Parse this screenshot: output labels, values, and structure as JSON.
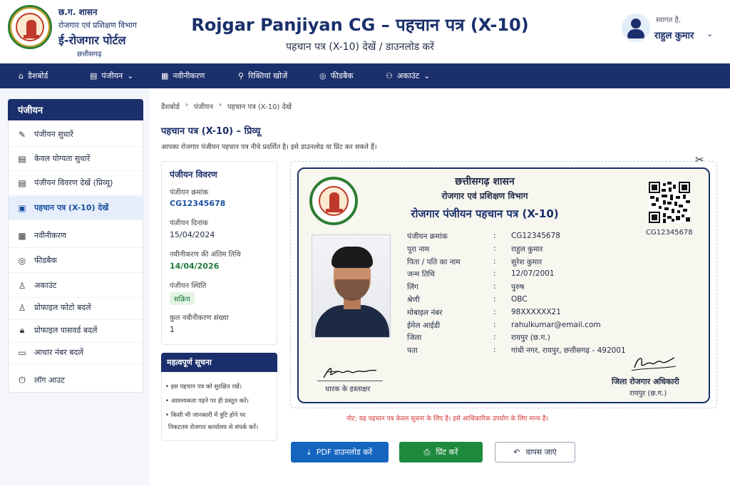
{
  "header": {
    "gov": "छ.ग. शासन",
    "dept": "रोजगार एवं प्रशिक्षण विभाग",
    "portal": "ई-रोजगार पोर्टल",
    "state": "छत्तीसगढ़",
    "title": "Rojgar Panjiyan CG – पहचान पत्र (X-10)",
    "subtitle": "पहचान पत्र (X-10) देखें / डाउनलोड करें",
    "welcome": "स्वागत है,",
    "user": "राहुल कुमार"
  },
  "nav": [
    {
      "label": "डैशबोर्ड",
      "icon": "home-icon"
    },
    {
      "label": "पंजीयन",
      "icon": "document-icon",
      "dropdown": true
    },
    {
      "label": "नवीनीकरण",
      "icon": "calendar-icon"
    },
    {
      "label": "रिक्तियां खोजें",
      "icon": "search-icon"
    },
    {
      "label": "फीडबैक",
      "icon": "feedback-icon"
    },
    {
      "label": "अकाउंट",
      "icon": "users-icon",
      "dropdown": true
    }
  ],
  "sidebar": {
    "title": "पंजीयन",
    "items": [
      {
        "label": "पंजीयन सुधारें",
        "icon": "edit-icon"
      },
      {
        "label": "केवल योग्यता सुधारें",
        "icon": "doc-edit-icon"
      },
      {
        "label": "पंजीयन विवरण देखें (प्रिव्यू)",
        "icon": "doc-view-icon"
      },
      {
        "label": "पहचान पत्र (X-10) देखें",
        "icon": "id-card-icon",
        "active": true
      },
      {
        "label": "नवीनीकरण",
        "icon": "calendar-icon"
      },
      {
        "label": "फीडबैक",
        "icon": "feedback-icon"
      },
      {
        "label": "अकाउंट",
        "icon": "user-icon"
      },
      {
        "label": "प्रोफाइल फोटो बदलें",
        "icon": "user-photo-icon"
      },
      {
        "label": "प्रोफाइल पासवर्ड बदलें",
        "icon": "lock-icon"
      },
      {
        "label": "आधार नंबर बदलें",
        "icon": "card-icon"
      },
      {
        "label": "लॉग आउट",
        "icon": "power-icon"
      }
    ]
  },
  "breadcrumb": [
    "डैशबोर्ड",
    "पंजीयन",
    "पहचान पत्र (X-10) देखें"
  ],
  "page": {
    "title": "पहचान पत्र (X-10) – प्रिव्यू",
    "desc": "आपका रोजगार पंजीयन पहचान पत्र नीचे प्रदर्शित है। इसे डाउनलोड या प्रिंट कर सकते हैं।"
  },
  "details": {
    "title": "पंजीयन विवरण",
    "reg_no_label": "पंजीयन क्रमांक",
    "reg_no": "CG12345678",
    "reg_date_label": "पंजीयन दिनांक",
    "reg_date": "15/04/2024",
    "renew_label": "नवीनीकरण की अंतिम तिथि",
    "renew_date": "14/04/2026",
    "status_label": "पंजीयन स्थिति",
    "status": "सक्रिय",
    "count_label": "कुल नवीनीकरण संख्या",
    "count": "1"
  },
  "notice": {
    "title": "महत्वपूर्ण सूचना",
    "items": [
      "• इस पहचान पत्र को सुरक्षित रखें।",
      "• आवश्यकता पड़ने पर ही प्रस्तुत करें।",
      "• किसी भी जानकारी में त्रुटि होने पर",
      "निकटतम रोजगार कार्यालय से संपर्क करें।"
    ]
  },
  "card": {
    "gov": "छत्तीसगढ़ शासन",
    "dept": "रोजगार एवं प्रशिक्षण विभाग",
    "title": "रोजगार पंजीयन पहचान पत्र (X-10)",
    "qr_id": "CG12345678",
    "fields": [
      {
        "label": "पंजीयन क्रमांक",
        "value": "CG12345678"
      },
      {
        "label": "पूरा नाम",
        "value": "राहुल कुमार"
      },
      {
        "label": "पिता / पति का नाम",
        "value": "सुरेश कुमार"
      },
      {
        "label": "जन्म तिथि",
        "value": "12/07/2001"
      },
      {
        "label": "लिंग",
        "value": "पुरुष"
      },
      {
        "label": "श्रेणी",
        "value": "OBC"
      },
      {
        "label": "मोबाइल नंबर",
        "value": "98XXXXXX21"
      },
      {
        "label": "ईमेल आईडी",
        "value": "rahulkumar@email.com"
      },
      {
        "label": "जिला",
        "value": "रायपुर (छ.ग.)"
      },
      {
        "label": "पता",
        "value": "गांधी नगर, रायपुर, छत्तीसगढ़ - 492001"
      }
    ],
    "holder_sig": "धारक के हस्ताक्षर",
    "officer": "जिला रोजगार अधिकारी",
    "officer_place": "रायपुर (छ.ग.)"
  },
  "note": "नोट: यह पहचान पत्र केवल सूचना के लिए है। इसे आधिकारिक उपयोग के लिए मान्य है।",
  "buttons": {
    "pdf": "PDF डाउनलोड करें",
    "print": "प्रिंट करें",
    "back": "वापस जाएं"
  },
  "colors": {
    "primary": "#1a2f6b",
    "green": "#1e8a3e",
    "blue": "#1565c0",
    "red": "#d32f2f"
  }
}
